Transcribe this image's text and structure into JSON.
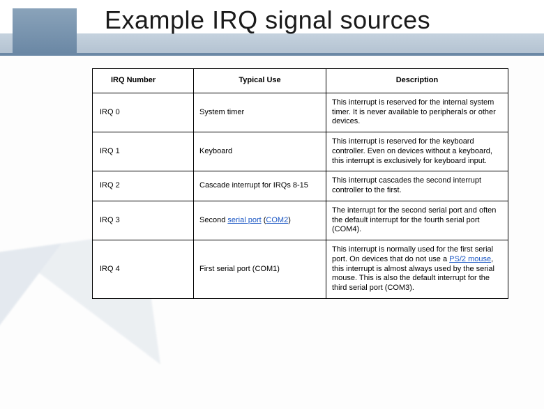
{
  "title": "Example IRQ signal sources",
  "headers": {
    "irq": "IRQ Number",
    "use": "Typical Use",
    "desc": "Description"
  },
  "rows": [
    {
      "irq": "IRQ 0",
      "use": [
        {
          "t": "System timer"
        }
      ],
      "desc": [
        {
          "t": "This interrupt is reserved for the internal system timer. It is never available to peripherals or other devices."
        }
      ]
    },
    {
      "irq": "IRQ 1",
      "use": [
        {
          "t": "Keyboard"
        }
      ],
      "desc": [
        {
          "t": "This interrupt is reserved for the keyboard controller. Even on devices without a keyboard, this interrupt is exclusively for keyboard input."
        }
      ]
    },
    {
      "irq": "IRQ 2",
      "use": [
        {
          "t": "Cascade interrupt for IRQs 8-15"
        }
      ],
      "desc": [
        {
          "t": "This interrupt cascades the second interrupt controller to the first."
        }
      ]
    },
    {
      "irq": "IRQ 3",
      "use": [
        {
          "t": "Second "
        },
        {
          "t": "serial port",
          "link": true
        },
        {
          "t": " ("
        },
        {
          "t": "COM2",
          "link": true
        },
        {
          "t": ")"
        }
      ],
      "desc": [
        {
          "t": "The interrupt for the second serial port and often the default interrupt for the fourth serial port (COM4)."
        }
      ]
    },
    {
      "irq": "IRQ 4",
      "use": [
        {
          "t": "First serial port (COM1)"
        }
      ],
      "desc": [
        {
          "t": "This interrupt is normally used for the first serial port. On devices that do not use a "
        },
        {
          "t": "PS/2 mouse",
          "link": true
        },
        {
          "t": ", this interrupt is almost always used by the serial mouse. This is also the default interrupt for the third serial port (COM3)."
        }
      ]
    }
  ]
}
